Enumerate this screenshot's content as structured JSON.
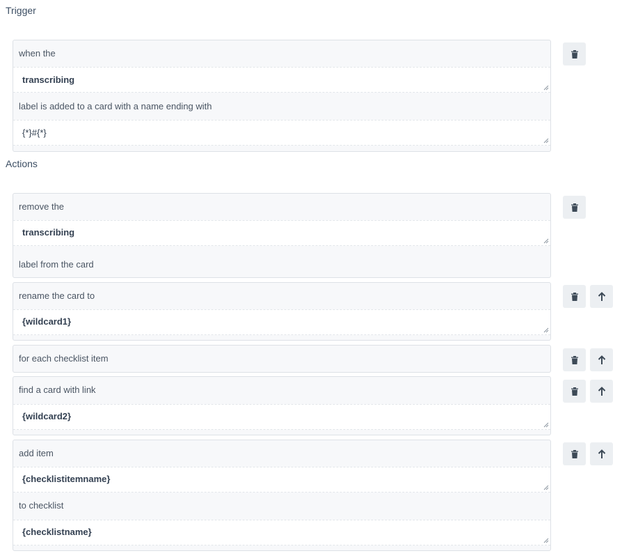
{
  "trigger": {
    "title": "Trigger",
    "line1": "when the",
    "label_value": "transcribing",
    "line2": "label is added to a card with a name ending with",
    "pattern_value": "{*}#{*}"
  },
  "actions": {
    "title": "Actions",
    "remove": {
      "line1": "remove the",
      "value": "transcribing",
      "line2": "label from the card"
    },
    "rename": {
      "line1": "rename the card to",
      "value": "{wildcard1}"
    },
    "foreach": {
      "line1": "for each checklist item"
    },
    "find": {
      "line1": "find a card with link",
      "value": "{wildcard2}"
    },
    "additem": {
      "line1": "add item",
      "value1": "{checklistitemname}",
      "line2": "to checklist",
      "value2": "{checklistname}"
    }
  },
  "icons": {
    "delete": "trash-icon",
    "move_up": "arrow-up-icon"
  }
}
